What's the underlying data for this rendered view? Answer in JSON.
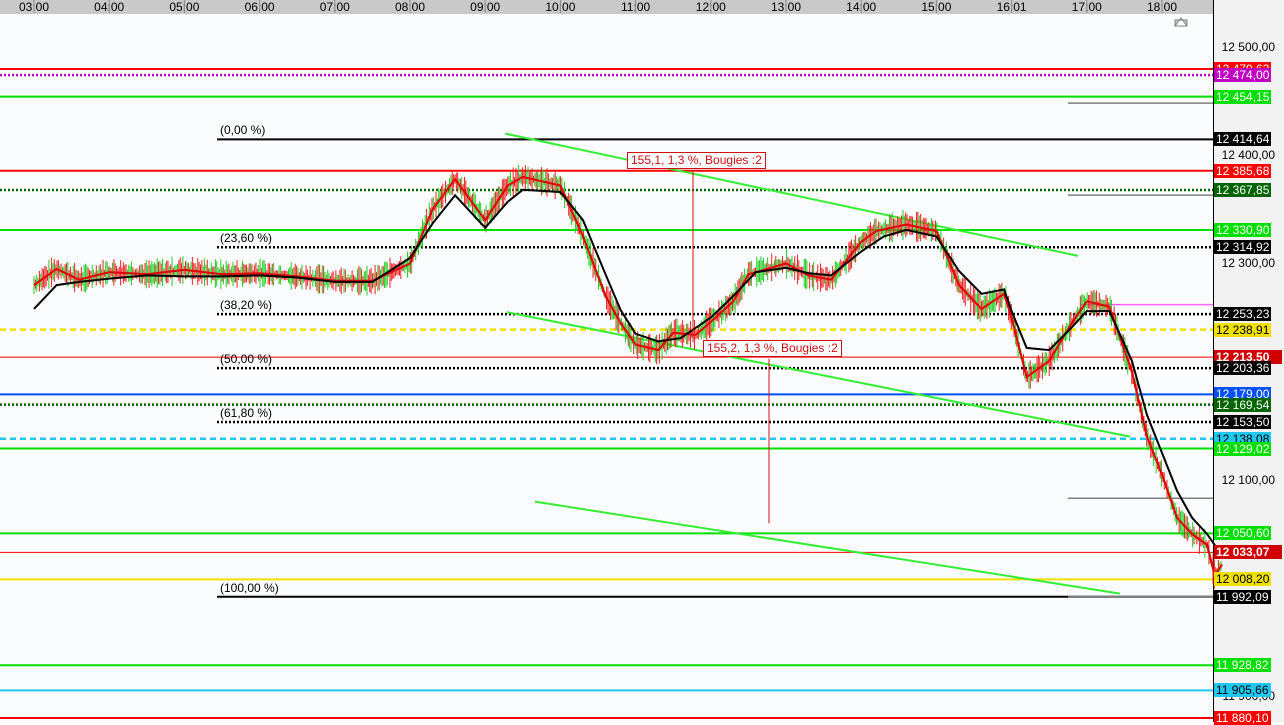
{
  "chart_data": {
    "type": "line",
    "x_axis_times": [
      "03:00",
      "04:00",
      "05:00",
      "06:00",
      "07:00",
      "08:00",
      "09:00",
      "10:00",
      "11:00",
      "12:00",
      "13:00",
      "14:00",
      "15:00",
      "16:01",
      "17:00",
      "18:00"
    ],
    "price_ticks": [
      "12 500,00",
      "12 400,00",
      "12 300,00",
      "12 100,00",
      "11 900,00"
    ],
    "ylim": [
      11880,
      12545
    ],
    "series": [
      {
        "color": "#e00000",
        "points": [
          [
            0,
            12280
          ],
          [
            0.3,
            12295
          ],
          [
            0.6,
            12285
          ],
          [
            1,
            12292
          ],
          [
            1.5,
            12290
          ],
          [
            2,
            12294
          ],
          [
            2.5,
            12290
          ],
          [
            3,
            12291
          ],
          [
            3.5,
            12288
          ],
          [
            4,
            12284
          ],
          [
            4.5,
            12284
          ],
          [
            5,
            12300
          ],
          [
            5.3,
            12350
          ],
          [
            5.6,
            12378
          ],
          [
            6,
            12340
          ],
          [
            6.3,
            12372
          ],
          [
            6.5,
            12380
          ],
          [
            7,
            12372
          ],
          [
            7.3,
            12325
          ],
          [
            7.6,
            12270
          ],
          [
            7.8,
            12245
          ],
          [
            8,
            12225
          ],
          [
            8.3,
            12220
          ],
          [
            8.5,
            12236
          ],
          [
            8.8,
            12234
          ],
          [
            9,
            12246
          ],
          [
            9.3,
            12265
          ],
          [
            9.5,
            12290
          ],
          [
            10,
            12300
          ],
          [
            10.3,
            12289
          ],
          [
            10.6,
            12285
          ],
          [
            11,
            12320
          ],
          [
            11.2,
            12330
          ],
          [
            11.6,
            12336
          ],
          [
            12,
            12330
          ],
          [
            12.3,
            12280
          ],
          [
            12.6,
            12258
          ],
          [
            12.9,
            12272
          ],
          [
            13,
            12250
          ],
          [
            13.2,
            12195
          ],
          [
            13.5,
            12210
          ],
          [
            13.8,
            12245
          ],
          [
            14,
            12265
          ],
          [
            14.3,
            12260
          ],
          [
            14.6,
            12200
          ],
          [
            14.8,
            12140
          ],
          [
            15,
            12105
          ],
          [
            15.2,
            12065
          ],
          [
            15.4,
            12050
          ],
          [
            15.6,
            12040
          ],
          [
            15.7,
            12012
          ],
          [
            15.8,
            12022
          ]
        ]
      },
      {
        "color": "#000000",
        "points": [
          [
            0,
            12258
          ],
          [
            0.3,
            12280
          ],
          [
            0.6,
            12283
          ],
          [
            1,
            12286
          ],
          [
            1.5,
            12289
          ],
          [
            2,
            12288
          ],
          [
            2.5,
            12288
          ],
          [
            3,
            12289
          ],
          [
            3.5,
            12287
          ],
          [
            4,
            12283
          ],
          [
            4.5,
            12283
          ],
          [
            5,
            12305
          ],
          [
            5.3,
            12337
          ],
          [
            5.6,
            12363
          ],
          [
            6,
            12333
          ],
          [
            6.3,
            12357
          ],
          [
            6.5,
            12368
          ],
          [
            7,
            12366
          ],
          [
            7.3,
            12340
          ],
          [
            7.6,
            12290
          ],
          [
            7.8,
            12257
          ],
          [
            8,
            12235
          ],
          [
            8.3,
            12228
          ],
          [
            8.6,
            12231
          ],
          [
            9,
            12250
          ],
          [
            9.3,
            12270
          ],
          [
            9.6,
            12292
          ],
          [
            10,
            12296
          ],
          [
            10.3,
            12291
          ],
          [
            10.6,
            12289
          ],
          [
            11,
            12311
          ],
          [
            11.3,
            12325
          ],
          [
            11.6,
            12331
          ],
          [
            12,
            12325
          ],
          [
            12.3,
            12293
          ],
          [
            12.6,
            12272
          ],
          [
            12.9,
            12276
          ],
          [
            13,
            12256
          ],
          [
            13.2,
            12222
          ],
          [
            13.5,
            12220
          ],
          [
            13.8,
            12241
          ],
          [
            14,
            12256
          ],
          [
            14.3,
            12256
          ],
          [
            14.6,
            12210
          ],
          [
            14.8,
            12160
          ],
          [
            15,
            12125
          ],
          [
            15.2,
            12090
          ],
          [
            15.4,
            12065
          ],
          [
            15.6,
            12050
          ],
          [
            15.8,
            12030
          ]
        ]
      }
    ],
    "horizontal_levels": [
      {
        "value": 12479.63,
        "label": "12 479,63",
        "color": "#ff0000",
        "style": "solid"
      },
      {
        "value": 12474.0,
        "label": "12 474,00",
        "color": "#c000c0",
        "style": "dotted"
      },
      {
        "value": 12454.15,
        "label": "12 454,15",
        "color": "#00e000",
        "style": "solid"
      },
      {
        "value": 12414.64,
        "label": "12 414,64",
        "color": "#000000",
        "style": "solid"
      },
      {
        "value": 12385.68,
        "label": "12 385,68",
        "color": "#ff0000",
        "style": "solid"
      },
      {
        "value": 12367.85,
        "label": "12 367,85",
        "color": "#006400",
        "style": "dotted"
      },
      {
        "value": 12330.9,
        "label": "12 330,90",
        "color": "#00e000",
        "style": "solid"
      },
      {
        "value": 12314.92,
        "label": "12 314,92",
        "color": "#000000",
        "style": "dotted"
      },
      {
        "value": 12253.23,
        "label": "12 253,23",
        "color": "#000000",
        "style": "dotted"
      },
      {
        "value": 12238.91,
        "label": "12 238,91",
        "color": "#f0e000",
        "style": "dashed"
      },
      {
        "value": 12213.5,
        "label": "12 213,50",
        "color": "#ff0000",
        "style": "thin"
      },
      {
        "value": 12203.36,
        "label": "12 203,36",
        "color": "#000000",
        "style": "dotted"
      },
      {
        "value": 12179.0,
        "label": "12 179,00",
        "color": "#0050ff",
        "style": "solid"
      },
      {
        "value": 12169.54,
        "label": "12 169,54",
        "color": "#006400",
        "style": "dotted"
      },
      {
        "value": 12153.5,
        "label": "12 153,50",
        "color": "#000000",
        "style": "dotted"
      },
      {
        "value": 12138.08,
        "label": "12 138,08",
        "color": "#20c8f0",
        "style": "dashed"
      },
      {
        "value": 12129.02,
        "label": "12 129,02",
        "color": "#00e000",
        "style": "solid"
      },
      {
        "value": 12050.6,
        "label": "12 050,60",
        "color": "#00e000",
        "style": "solid"
      },
      {
        "value": 12033.07,
        "label": "12 033,07",
        "color": "#ff0000",
        "style": "thin"
      },
      {
        "value": 12008.2,
        "label": "12 008,20",
        "color": "#f0e000",
        "style": "solid"
      },
      {
        "value": 11992.09,
        "label": "11 992,09",
        "color": "#000000",
        "style": "solid"
      },
      {
        "value": 11928.82,
        "label": "11 928,82",
        "color": "#00e000",
        "style": "solid"
      },
      {
        "value": 11905.66,
        "label": "11 905,66",
        "color": "#20c8f0",
        "style": "solid"
      },
      {
        "value": 11880.1,
        "label": "11 880,10",
        "color": "#ff0000",
        "style": "solid"
      }
    ],
    "fibonacci_labels": [
      {
        "value": 12414.64,
        "text": "(0,00 %)"
      },
      {
        "value": 12314.92,
        "text": "(23,60 %)"
      },
      {
        "value": 12253.23,
        "text": "(38,20 %)"
      },
      {
        "value": 12203.36,
        "text": "(50,00 %)"
      },
      {
        "value": 12153.5,
        "text": "(61,80 %)"
      },
      {
        "value": 11992.09,
        "text": "(100,00 %)"
      }
    ],
    "annotations": [
      {
        "text": "155,1, 1,3 %, Bougies :2"
      },
      {
        "text": "155,2, 1,3 %, Bougies :2"
      }
    ]
  }
}
